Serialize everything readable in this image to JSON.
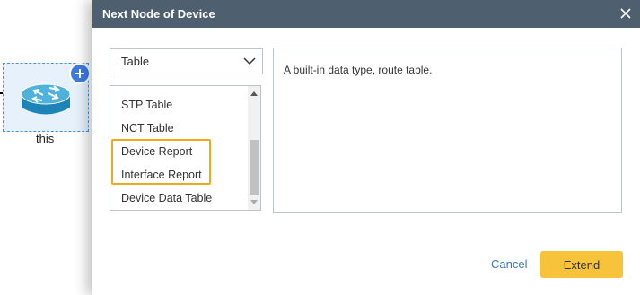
{
  "canvas": {
    "node_label": "this"
  },
  "dialog": {
    "title": "Next Node of Device",
    "type_select": {
      "value": "Table"
    },
    "list_items": [
      {
        "label": "STP Table"
      },
      {
        "label": "NCT Table"
      },
      {
        "label": "Device Report"
      },
      {
        "label": "Interface Report"
      },
      {
        "label": "Device Data Table"
      }
    ],
    "description": "A built-in data type, route table.",
    "buttons": {
      "cancel": "Cancel",
      "extend": "Extend"
    }
  },
  "colors": {
    "titlebar": "#4e5f6f",
    "accent_button": "#f7c33b",
    "highlight_border": "#f0a91c",
    "link": "#3a78b6"
  }
}
